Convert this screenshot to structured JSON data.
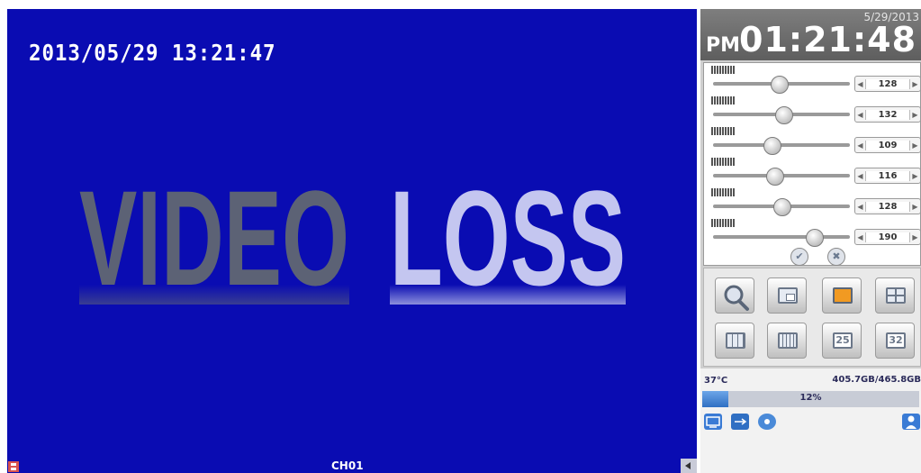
{
  "video": {
    "osd_datetime": "2013/05/29  13:21:47",
    "video_loss_word1": "VIDEO",
    "video_loss_word2": "LOSS",
    "channel_label": "CH01",
    "background_color": "#0a0cb2"
  },
  "clock": {
    "date": "5/29/2013",
    "ampm": "PM",
    "time": "01:21:48"
  },
  "image_adjust": {
    "sliders": [
      {
        "level": 0.48,
        "value": "128"
      },
      {
        "level": 0.51,
        "value": "132"
      },
      {
        "level": 0.43,
        "value": "109"
      },
      {
        "level": 0.45,
        "value": "116"
      },
      {
        "level": 0.5,
        "value": "128"
      },
      {
        "level": 0.74,
        "value": "190"
      }
    ],
    "confirm_icon": "check-icon",
    "cancel_icon": "close-icon"
  },
  "layouts": {
    "buttons": [
      "magnifier",
      "pip",
      "single",
      "quad",
      "grid-9",
      "grid-16",
      "25",
      "32"
    ],
    "labels": {
      "grid25": "25",
      "grid32": "32"
    }
  },
  "status": {
    "temperature": "37°C",
    "disk_space": "405.7GB/465.8GB",
    "disk_usage_percent": 12,
    "disk_usage_label": "12%"
  }
}
